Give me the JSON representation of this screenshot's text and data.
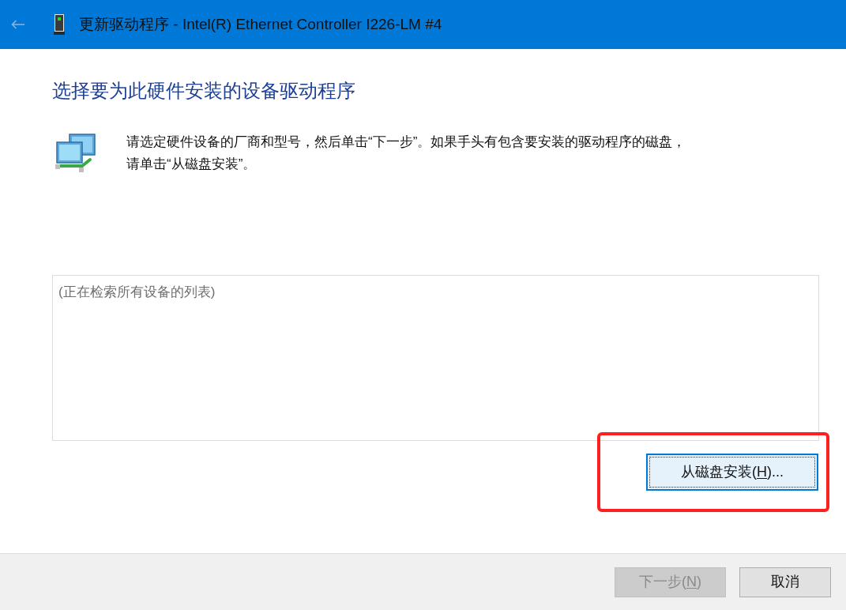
{
  "title_bar": {
    "back_button": {
      "disabled": true
    },
    "title": "更新驱动程序 - Intel(R) Ethernet Controller I226-LM #4"
  },
  "heading": "选择要为此硬件安装的设备驱动程序",
  "instructions": [
    "请选定硬件设备的厂商和型号，然后单击“下一步”。如果手头有包含要安装的驱动程序的磁盘，",
    "请单击“从磁盘安装”。"
  ],
  "device_list": {
    "status_text": "(正在检索所有设备的列表)"
  },
  "have_disk_button": {
    "label_before": "从磁盘安装(",
    "access_key": "H",
    "label_after": ")...",
    "focused": true,
    "highlighted": true
  },
  "footer_buttons": [
    {
      "label_before": "下一步(",
      "access_key": "N",
      "label_after": ")",
      "disabled": true
    },
    {
      "label_before": "取消",
      "disabled": false
    }
  ]
}
